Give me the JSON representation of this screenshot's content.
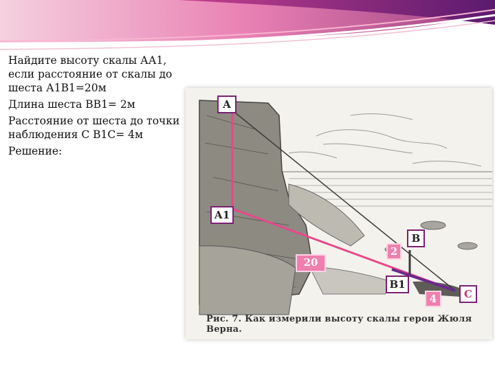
{
  "problem": {
    "line1": "Найдите высоту скалы  АА1, если расстояние от скалы до шеста   А1В1=20м",
    "line2": "Длина шеста       ВВ1= 2м",
    "line3": "Расстояние от шеста до точки наблюдения С    В1С= 4м",
    "line4": "Решение:"
  },
  "figure": {
    "labels": {
      "A": "А",
      "A1": "А1",
      "B": "В",
      "B1": "В1",
      "C": "С"
    },
    "numbers": {
      "height": "2",
      "distance": "20",
      "base": "4"
    },
    "caption": "Рис. 7. Как измерили высоту скалы герои Жюля Верна.",
    "colors": {
      "pink_line": "#e8478b",
      "dark_line": "#3a3a3a",
      "label_border": "#7a1f73",
      "number_bg": "#f07fae"
    }
  }
}
